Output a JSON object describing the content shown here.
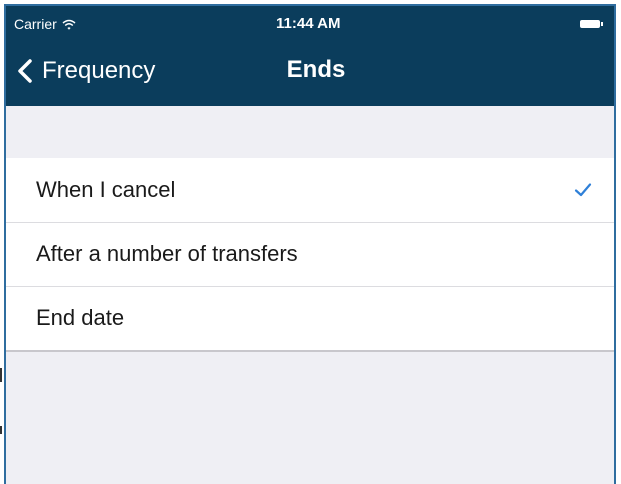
{
  "status_bar": {
    "carrier": "Carrier",
    "wifi_icon": "wifi-icon",
    "time": "11:44 AM",
    "battery_icon": "battery-icon"
  },
  "navbar": {
    "back_label": "Frequency",
    "back_icon": "chevron-left-icon",
    "title": "Ends",
    "background_color": "#0b3d5c"
  },
  "options": {
    "items": [
      {
        "label": "When I cancel",
        "selected": true
      },
      {
        "label": "After a number of transfers",
        "selected": false
      },
      {
        "label": "End date",
        "selected": false
      }
    ],
    "check_icon": "checkmark-icon",
    "check_color": "#2f80d8"
  },
  "colors": {
    "background": "#efeff4",
    "frame_border": "#2f6d9f",
    "row_background": "#ffffff",
    "separator": "#dcdce0"
  }
}
